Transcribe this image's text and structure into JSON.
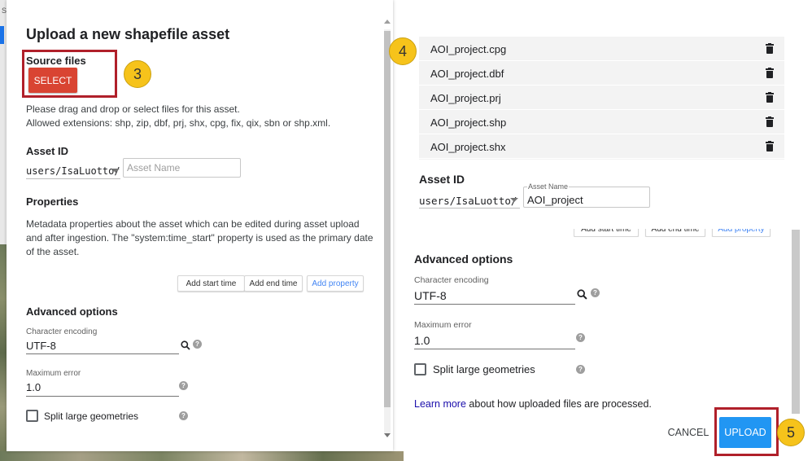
{
  "background": {
    "corner_text": "S"
  },
  "left_dialog": {
    "title": "Upload a new shapefile asset",
    "source_files_label": "Source files",
    "select_button": "SELECT",
    "step_badge": "3",
    "drag_text": "Please drag and drop or select files for this asset.",
    "extensions_text": "Allowed extensions: shp, zip, dbf, prj, shx, cpg, fix, qix, sbn or shp.xml.",
    "asset_id_label": "Asset ID",
    "asset_id_prefix": "users/IsaLuotto/",
    "asset_name_placeholder": "Asset Name",
    "properties_label": "Properties",
    "properties_text_1": "Metadata properties about the asset which can be edited during asset upload",
    "properties_text_2": "and after ingestion. The \"system:time_start\" property is used as the primary date",
    "properties_text_3": "of the asset.",
    "add_start_time": "Add start time",
    "add_end_time": "Add end time",
    "add_property": "Add property",
    "advanced_label": "Advanced options",
    "char_encoding_label": "Character encoding",
    "char_encoding_value": "UTF-8",
    "max_error_label": "Maximum error",
    "max_error_value": "1.0",
    "split_label": "Split large geometries"
  },
  "right_panel": {
    "step_badge_files": "4",
    "files": [
      "AOI_project.cpg",
      "AOI_project.dbf",
      "AOI_project.prj",
      "AOI_project.shp",
      "AOI_project.shx"
    ],
    "asset_id_label": "Asset ID",
    "asset_id_prefix": "users/IsaLuotto/",
    "asset_name_float_label": "Asset Name",
    "asset_name_value": "AOI_project",
    "peek_start": "Add start time",
    "peek_end": "Add end time",
    "peek_property": "Add property",
    "advanced_label": "Advanced options",
    "char_encoding_label": "Character encoding",
    "char_encoding_value": "UTF-8",
    "max_error_label": "Maximum error",
    "max_error_value": "1.0",
    "split_label": "Split large geometries",
    "learn_link": "Learn more",
    "learn_rest": " about how uploaded files are processed.",
    "cancel_button": "CANCEL",
    "upload_button": "UPLOAD",
    "step_badge_upload": "5"
  },
  "colors": {
    "select_red": "#d94432",
    "highlight_red": "#b0202a",
    "badge_yellow": "#f6c31b",
    "upload_blue": "#2196f3",
    "link_blue": "#1a0dab"
  }
}
